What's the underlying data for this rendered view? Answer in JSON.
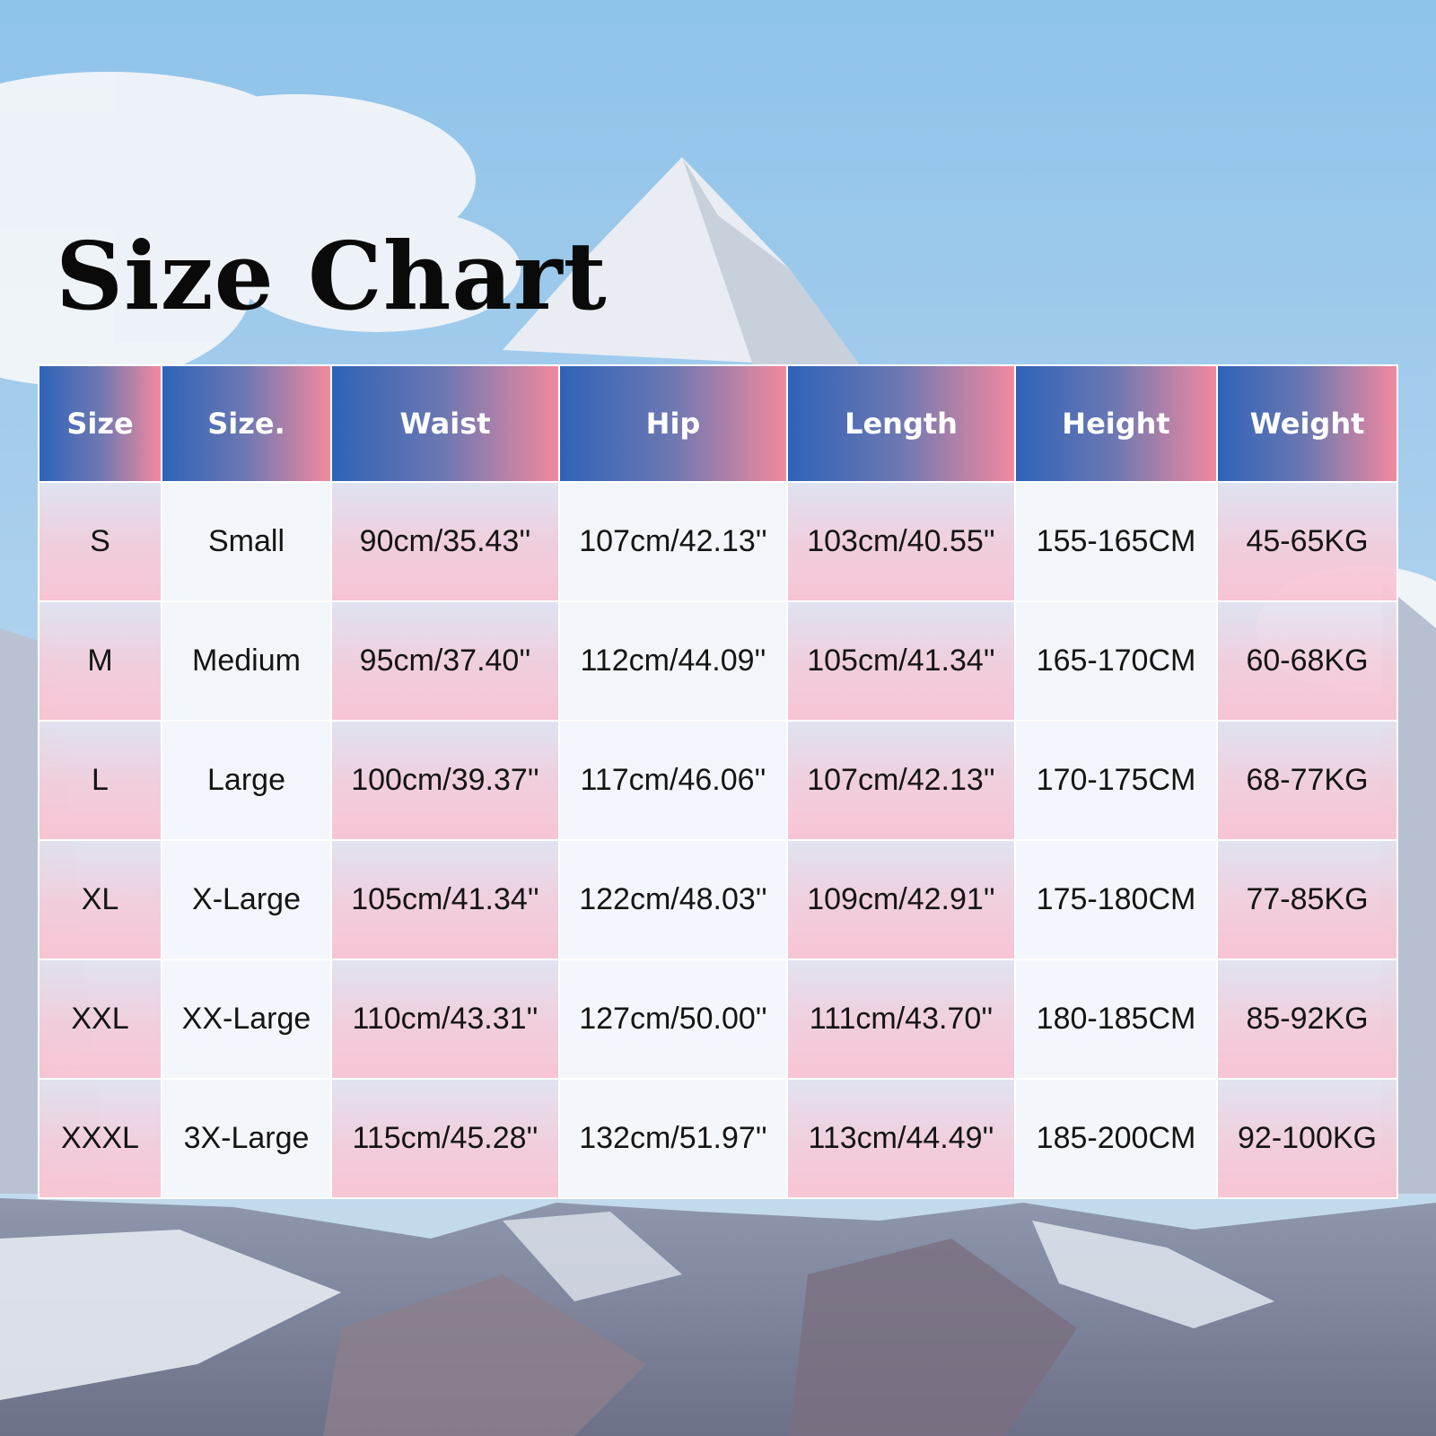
{
  "title": "Size Chart",
  "headers": [
    "Size",
    "Size.",
    "Waist",
    "Hip",
    "Length",
    "Height",
    "Weight"
  ],
  "rows": [
    [
      "S",
      "Small",
      "90cm/35.43''",
      "107cm/42.13''",
      "103cm/40.55''",
      "155-165CM",
      "45-65KG"
    ],
    [
      "M",
      "Medium",
      "95cm/37.40''",
      "112cm/44.09''",
      "105cm/41.34''",
      "165-170CM",
      "60-68KG"
    ],
    [
      "L",
      "Large",
      "100cm/39.37''",
      "117cm/46.06''",
      "107cm/42.13''",
      "170-175CM",
      "68-77KG"
    ],
    [
      "XL",
      "X-Large",
      "105cm/41.34''",
      "122cm/48.03''",
      "109cm/42.91''",
      "175-180CM",
      "77-85KG"
    ],
    [
      "XXL",
      "XX-Large",
      "110cm/43.31''",
      "127cm/50.00''",
      "111cm/43.70''",
      "180-185CM",
      "85-92KG"
    ],
    [
      "XXXL",
      "3X-Large",
      "115cm/45.28''",
      "132cm/51.97''",
      "113cm/44.49''",
      "185-200CM",
      "92-100KG"
    ]
  ],
  "colors": {
    "header_start": "#2e63b8",
    "header_end": "#f2899e",
    "row_pink": "#f6c6d6",
    "row_white": "#f6f8fc",
    "sky": "#9ec8e8"
  }
}
